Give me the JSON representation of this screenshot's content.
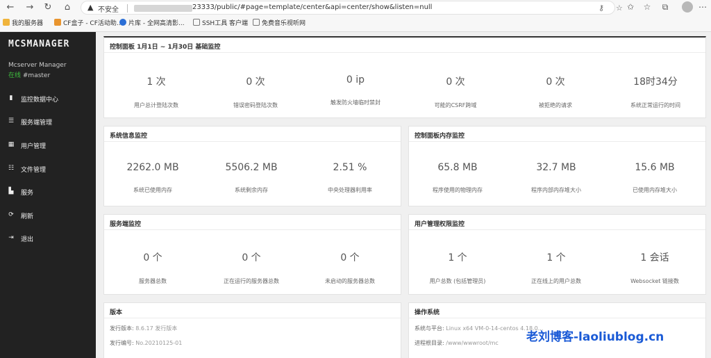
{
  "browser": {
    "insecure_label": "不安全",
    "url": "23333/public/#page=template/center&api=center/show&listen=null",
    "bookmarks": [
      "我的服务器",
      "CF盒子 - CF活动助...",
      "片库 - 全网高清影...",
      "SSH工具 客户端",
      "免费音乐视听网"
    ]
  },
  "sidebar": {
    "logo": "MCSMANAGER",
    "subtitle": "Mcserver Manager",
    "status_online": "在线",
    "status_user": "#master",
    "items": [
      {
        "label": "监控数据中心",
        "icon": "bar-chart-icon"
      },
      {
        "label": "服务端管理",
        "icon": "server-list-icon"
      },
      {
        "label": "用户管理",
        "icon": "user-grid-icon"
      },
      {
        "label": "文件管理",
        "icon": "file-list-icon"
      },
      {
        "label": "服务",
        "icon": "service-icon"
      },
      {
        "label": "刷新",
        "icon": "refresh-icon"
      },
      {
        "label": "退出",
        "icon": "logout-icon"
      }
    ]
  },
  "panels": {
    "basic": {
      "title": "控制面板 1月1日 ~ 1月30日 基础监控",
      "stats": [
        {
          "value": "1 次",
          "label": "用户总计登陆次数"
        },
        {
          "value": "0 次",
          "label": "错误密码登陆次数"
        },
        {
          "value": "0 ip",
          "label": "触发防火墙临时禁封"
        },
        {
          "value": "0 次",
          "label": "可能的CSRF跨域"
        },
        {
          "value": "0 次",
          "label": "被拒绝的请求"
        },
        {
          "value": "18时34分",
          "label": "系统正常运行的时间"
        }
      ]
    },
    "system": {
      "title": "系统信息监控",
      "stats": [
        {
          "value": "2262.0 MB",
          "label": "系统已使用内存"
        },
        {
          "value": "5506.2 MB",
          "label": "系统剩余内存"
        },
        {
          "value": "2.51 %",
          "label": "中央处理器利用率"
        }
      ]
    },
    "memory": {
      "title": "控制面板内存监控",
      "stats": [
        {
          "value": "65.8 MB",
          "label": "程序使用的物理内存"
        },
        {
          "value": "32.7 MB",
          "label": "程序内部内存堆大小"
        },
        {
          "value": "15.6 MB",
          "label": "已使用内存堆大小"
        }
      ]
    },
    "server": {
      "title": "服务端监控",
      "stats": [
        {
          "value": "0 个",
          "label": "服务器总数"
        },
        {
          "value": "0 个",
          "label": "正在运行的服务器总数"
        },
        {
          "value": "0 个",
          "label": "未启动的服务器总数"
        }
      ]
    },
    "users": {
      "title": "用户管理权限监控",
      "stats": [
        {
          "value": "1 个",
          "label": "用户总数 (包括管理员)"
        },
        {
          "value": "1 个",
          "label": "正在线上的用户总数"
        },
        {
          "value": "1 会话",
          "label": "Websocket 链接数"
        }
      ]
    },
    "version": {
      "title": "版本",
      "rows": [
        {
          "key": "发行版本:",
          "value": "8.6.17 发行版本"
        },
        {
          "key": "发行编号:",
          "value": "No.20210125-01"
        }
      ]
    },
    "os": {
      "title": "操作系统",
      "rows": [
        {
          "key": "系统与平台:",
          "value": "Linux x64 VM-0-14-centos 4.18.0..."
        },
        {
          "key": "进程根目录:",
          "value": "/www/wwwroot/mc"
        }
      ]
    }
  },
  "watermark": "老刘博客-laoliublog.cn"
}
